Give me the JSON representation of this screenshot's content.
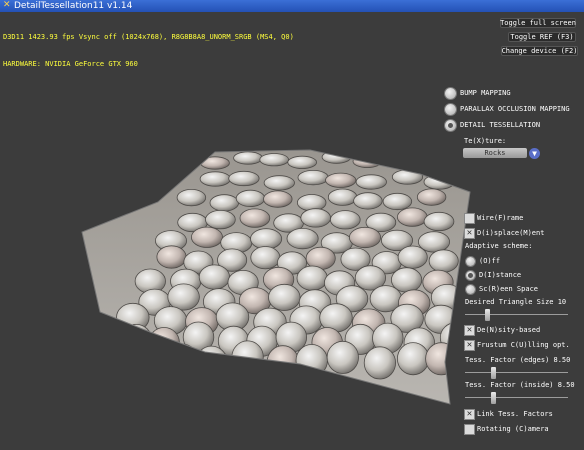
{
  "window": {
    "title": "DetailTessellation11 v1.14"
  },
  "stats": {
    "line1": "D3D11 1423.93 fps Vsync off (1024x768), R8G8B8A8_UNORM_SRGB (MS4, Q0)",
    "line2": "HARDWARE: NVIDIA GeForce GTX 960"
  },
  "buttons": {
    "toggle_full": "Toggle full screen",
    "toggle_ref": "Toggle REF (F3)",
    "change_device": "Change device (F2)"
  },
  "techniques": [
    {
      "label": "BUMP MAPPING",
      "selected": false
    },
    {
      "label": "PARALLAX OCCLUSION MAPPING",
      "selected": false
    },
    {
      "label": "DETAIL TESSELLATION",
      "selected": true
    }
  ],
  "texture": {
    "label": "Te(X)ture:",
    "value": "Rocks"
  },
  "wireframe": {
    "label": "Wire(F)rame",
    "checked": false
  },
  "displacement": {
    "label": "D(i)splace(M)ent",
    "checked": true
  },
  "adaptive": {
    "label": "Adaptive scheme:",
    "options": [
      {
        "label": "(O)ff",
        "selected": false
      },
      {
        "label": "D(I)stance",
        "selected": true
      },
      {
        "label": "Sc(R)een Space",
        "selected": false
      }
    ]
  },
  "triangle_size": {
    "label": "Desired Triangle Size 10",
    "level": 0.2
  },
  "density": {
    "label": "De(N)sity-based",
    "checked": true
  },
  "frustum": {
    "label": "Frustum C(U)lling opt.",
    "checked": true
  },
  "tess_edges": {
    "label": "Tess. Factor (edges) 8.50",
    "level": 0.27
  },
  "tess_inside": {
    "label": "Tess. Factor (inside) 8.50",
    "level": 0.27
  },
  "link_tess": {
    "label": "Link Tess. Factors",
    "checked": true
  },
  "rotating": {
    "label": "Rotating (C)amera",
    "checked": false
  },
  "colors": {
    "stats": "#ffff3c",
    "background": "#3c3c3c"
  }
}
